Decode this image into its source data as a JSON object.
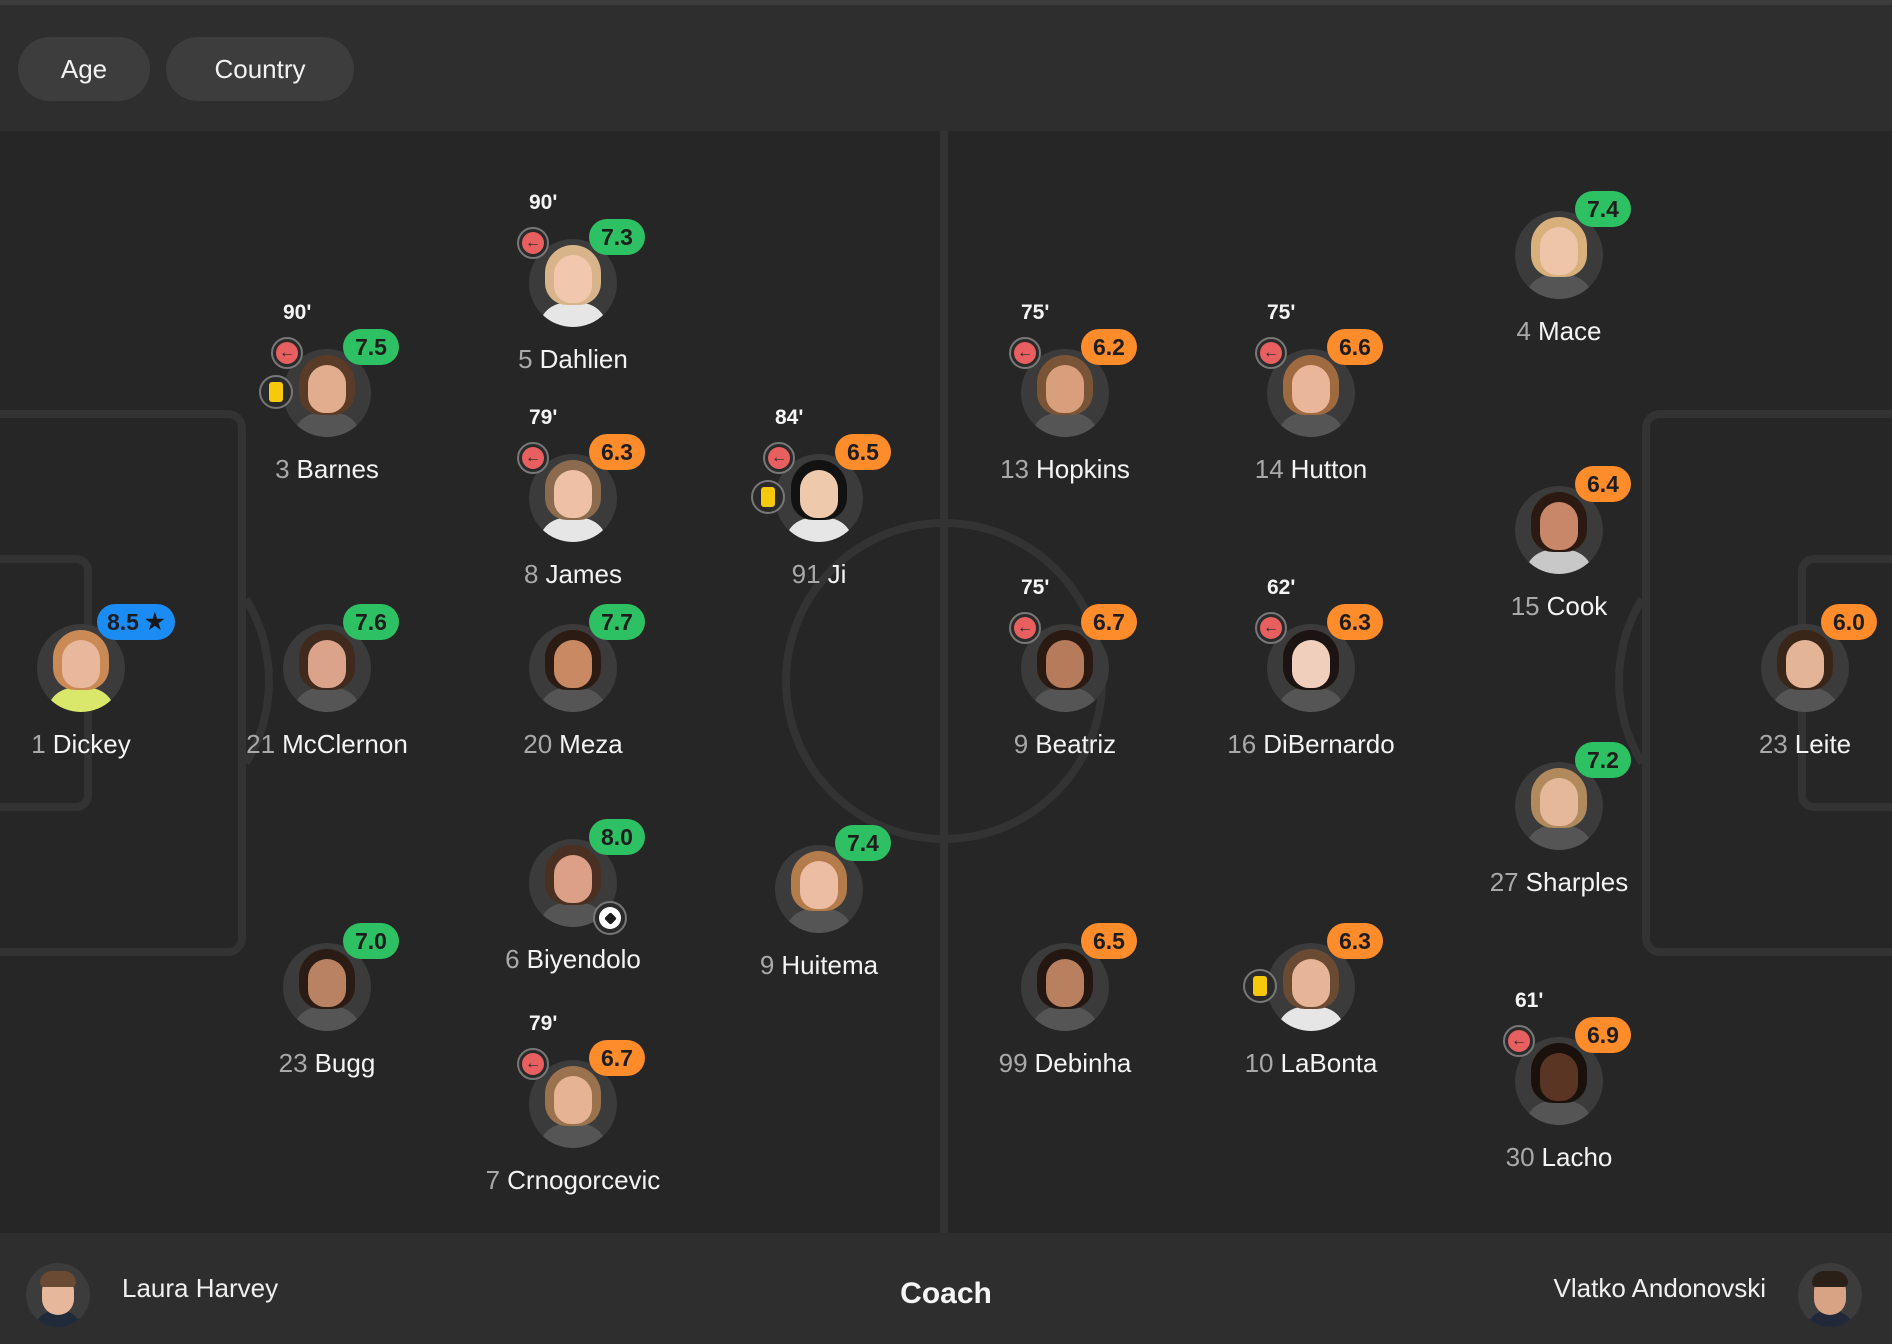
{
  "filters": {
    "age_label": "Age",
    "country_label": "Country"
  },
  "colors": {
    "rating_green": "#2ec163",
    "rating_orange": "#ff8c2a",
    "rating_blue": "#1c8cf5",
    "sub_red": "#e85f60",
    "yellow_card": "#f7c90c"
  },
  "players": [
    {
      "number": "1",
      "name": "Dickey",
      "rating": "8.5",
      "rating_color": "blue",
      "star": true,
      "skin": "#e9b79c",
      "hair": "#c98a56",
      "shirt": "#d9e86a"
    },
    {
      "number": "3",
      "name": "Barnes",
      "rating": "7.5",
      "rating_color": "green",
      "minute": "90'",
      "sub_off": true,
      "yellow_card": true,
      "skin": "#e2ad8f",
      "hair": "#5a3b27",
      "shirt": "#555555"
    },
    {
      "number": "21",
      "name": "McClernon",
      "rating": "7.6",
      "rating_color": "green",
      "skin": "#dba48a",
      "hair": "#3f2a1d",
      "shirt": "#555555"
    },
    {
      "number": "23",
      "name": "Bugg",
      "rating": "7.0",
      "rating_color": "green",
      "skin": "#b98363",
      "hair": "#2a1c14",
      "shirt": "#555555"
    },
    {
      "number": "5",
      "name": "Dahlien",
      "rating": "7.3",
      "rating_color": "green",
      "minute": "90'",
      "sub_off": true,
      "skin": "#f1c7ae",
      "hair": "#d8b48a",
      "shirt": "#e6e6e6"
    },
    {
      "number": "8",
      "name": "James",
      "rating": "6.3",
      "rating_color": "orange",
      "minute": "79'",
      "sub_off": true,
      "skin": "#eec1a7",
      "hair": "#8c6a4e",
      "shirt": "#e6e6e6"
    },
    {
      "number": "20",
      "name": "Meza",
      "rating": "7.7",
      "rating_color": "green",
      "skin": "#c98a63",
      "hair": "#2b1b12",
      "shirt": "#555555"
    },
    {
      "number": "6",
      "name": "Biyendolo",
      "rating": "8.0",
      "rating_color": "green",
      "goal": true,
      "skin": "#dca086",
      "hair": "#4a3022",
      "shirt": "#555555"
    },
    {
      "number": "7",
      "name": "Crnogorcevic",
      "rating": "6.7",
      "rating_color": "orange",
      "minute": "79'",
      "sub_off": true,
      "skin": "#e6b494",
      "hair": "#9a734e",
      "shirt": "#555555"
    },
    {
      "number": "91",
      "name": "Ji",
      "rating": "6.5",
      "rating_color": "orange",
      "minute": "84'",
      "sub_off": true,
      "yellow_card": true,
      "skin": "#efc9ab",
      "hair": "#121212",
      "shirt": "#e6e6e6"
    },
    {
      "number": "9",
      "name": "Huitema",
      "rating": "7.4",
      "rating_color": "green",
      "skin": "#ecbda3",
      "hair": "#b47c4b",
      "shirt": "#555555"
    },
    {
      "number": "13",
      "name": "Hopkins",
      "rating": "6.2",
      "rating_color": "orange",
      "minute": "75'",
      "sub_off": true,
      "skin": "#d99f7c",
      "hair": "#7a5436",
      "shirt": "#555555"
    },
    {
      "number": "14",
      "name": "Hutton",
      "rating": "6.6",
      "rating_color": "orange",
      "minute": "75'",
      "sub_off": true,
      "skin": "#eab69a",
      "hair": "#a06a40",
      "shirt": "#555555"
    },
    {
      "number": "9",
      "name": "Beatriz",
      "rating": "6.7",
      "rating_color": "orange",
      "minute": "75'",
      "sub_off": true,
      "skin": "#b57b5a",
      "hair": "#2a1a12",
      "shirt": "#555555"
    },
    {
      "number": "16",
      "name": "DiBernardo",
      "rating": "6.3",
      "rating_color": "orange",
      "minute": "62'",
      "sub_off": true,
      "skin": "#f0d0bd",
      "hair": "#1b1412",
      "shirt": "#555555"
    },
    {
      "number": "99",
      "name": "Debinha",
      "rating": "6.5",
      "rating_color": "orange",
      "skin": "#b8805f",
      "hair": "#241712",
      "shirt": "#555555"
    },
    {
      "number": "10",
      "name": "LaBonta",
      "rating": "6.3",
      "rating_color": "orange",
      "yellow_card": true,
      "skin": "#e6b497",
      "hair": "#6a4a32",
      "shirt": "#e6e6e6"
    },
    {
      "number": "4",
      "name": "Mace",
      "rating": "7.4",
      "rating_color": "green",
      "skin": "#efc5a9",
      "hair": "#d8b07c",
      "shirt": "#555555"
    },
    {
      "number": "15",
      "name": "Cook",
      "rating": "6.4",
      "rating_color": "orange",
      "skin": "#c9876a",
      "hair": "#2a1a12",
      "shirt": "#c8c8c8"
    },
    {
      "number": "27",
      "name": "Sharples",
      "rating": "7.2",
      "rating_color": "green",
      "skin": "#e6b89a",
      "hair": "#b08a5c",
      "shirt": "#555555"
    },
    {
      "number": "30",
      "name": "Lacho",
      "rating": "6.9",
      "rating_color": "orange",
      "minute": "61'",
      "sub_off": true,
      "skin": "#5a3524",
      "hair": "#1a110c",
      "shirt": "#555555"
    },
    {
      "number": "23",
      "name": "Leite",
      "rating": "6.0",
      "rating_color": "orange",
      "skin": "#e4b497",
      "hair": "#3a2618",
      "shirt": "#555555"
    }
  ],
  "coach": {
    "title": "Coach",
    "home_name": "Laura Harvey",
    "away_name": "Vlatko Andonovski"
  }
}
